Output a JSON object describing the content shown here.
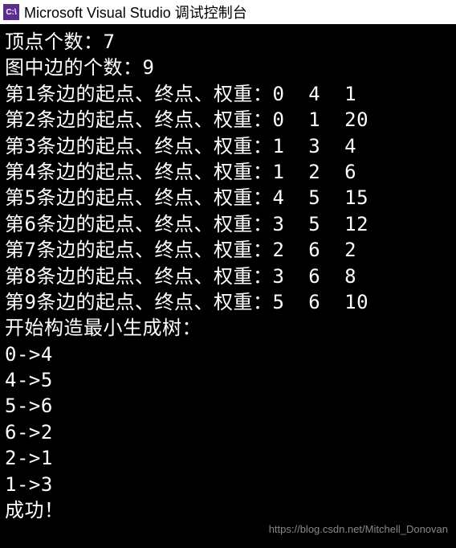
{
  "window": {
    "icon_text": "C:\\",
    "title": "Microsoft Visual Studio 调试控制台"
  },
  "console": {
    "lines": [
      "顶点个数：7",
      "图中边的个数：9",
      "第1条边的起点、终点、权重：0  4  1",
      "第2条边的起点、终点、权重：0  1  20",
      "第3条边的起点、终点、权重：1  3  4",
      "第4条边的起点、终点、权重：1  2  6",
      "第5条边的起点、终点、权重：4  5  15",
      "第6条边的起点、终点、权重：3  5  12",
      "第7条边的起点、终点、权重：2  6  2",
      "第8条边的起点、终点、权重：3  6  8",
      "第9条边的起点、终点、权重：5  6  10",
      "开始构造最小生成树：",
      "0->4",
      "4->5",
      "5->6",
      "6->2",
      "2->1",
      "1->3",
      "成功！"
    ]
  },
  "watermark": "https://blog.csdn.net/Mitchell_Donovan"
}
